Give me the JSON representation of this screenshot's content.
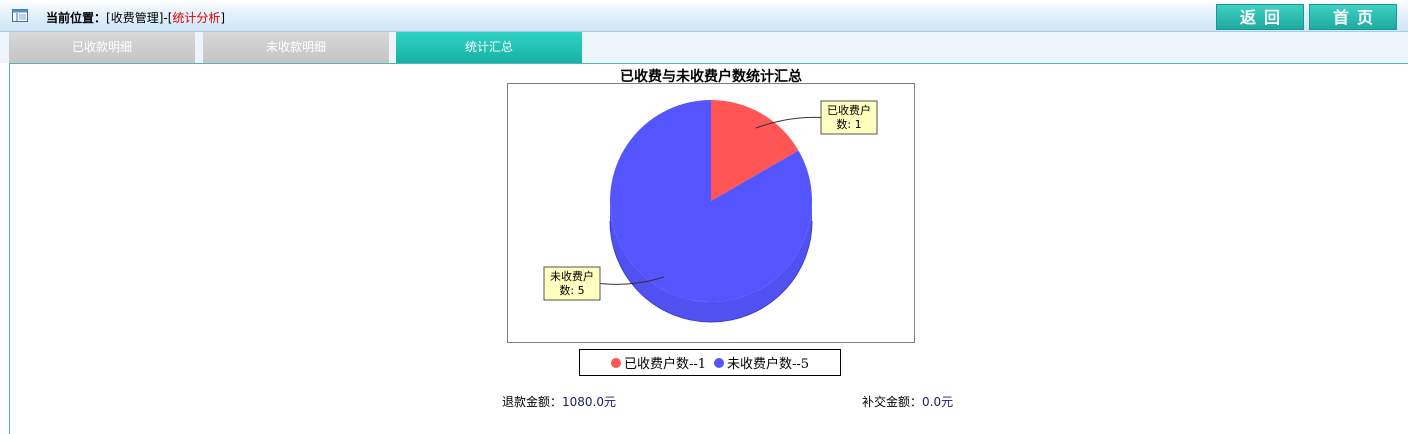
{
  "header": {
    "location_label": "当前位置：",
    "breadcrumb_prefix": "[收费管理]-[",
    "breadcrumb_current": "统计分析",
    "breadcrumb_suffix": "]",
    "back_button": "返回",
    "home_button": "首页"
  },
  "tabs": [
    {
      "label": "已收款明细",
      "active": false
    },
    {
      "label": "未收款明细",
      "active": false
    },
    {
      "label": "统计汇总",
      "active": true
    }
  ],
  "chart_data": {
    "type": "pie",
    "title": "已收费与未收费户数统计汇总",
    "slices": [
      {
        "label": "已收费户数",
        "value": 1,
        "color": "#ff5555",
        "callout": [
          "已收费户",
          "数: 1"
        ]
      },
      {
        "label": "未收费户数",
        "value": 5,
        "color": "#5555ff",
        "callout": [
          "未收费户",
          "数: 5"
        ]
      }
    ],
    "legend": [
      "已收费户数--1",
      "未收费户数--5"
    ],
    "legend_placement": "bottom"
  },
  "summary": {
    "refund_label": "退款金额：",
    "refund_value": "1080.0元",
    "supplement_label": "补交金额：",
    "supplement_value": "0.0元"
  }
}
